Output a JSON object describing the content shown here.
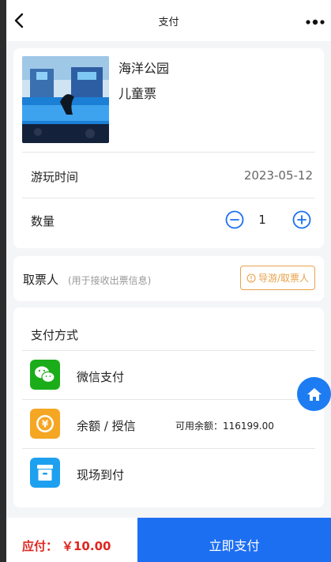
{
  "header": {
    "title": "支付",
    "back_icon": "chevron-left-icon",
    "more_icon": "more-dots-icon"
  },
  "product": {
    "name": "海洋公园",
    "ticket_type": "儿童票",
    "thumbnail_icon": "orca-show-photo",
    "visit_time_label": "游玩时间",
    "visit_date": "2023-05-12",
    "quantity_label": "数量",
    "quantity": "1"
  },
  "pickup": {
    "label": "取票人",
    "hint": "(用于接收出票信息)",
    "guide_button": "导游/取票人"
  },
  "payment": {
    "title": "支付方式",
    "methods": [
      {
        "name": "微信支付",
        "icon": "wechat-icon",
        "color": "#1aad19"
      },
      {
        "name": "余额 / 授信",
        "icon": "yen-coin-icon",
        "color": "#f5a623",
        "extra": "可用余额：116199.00"
      },
      {
        "name": "现场到付",
        "icon": "box-icon",
        "color": "#1ea0f0"
      }
    ]
  },
  "footer": {
    "due_label": "应付：",
    "due_amount": "￥10.00",
    "pay_button": "立即支付"
  },
  "colors": {
    "primary": "#1d6ff2",
    "price": "#e0251f",
    "guide": "#e8a24a"
  }
}
